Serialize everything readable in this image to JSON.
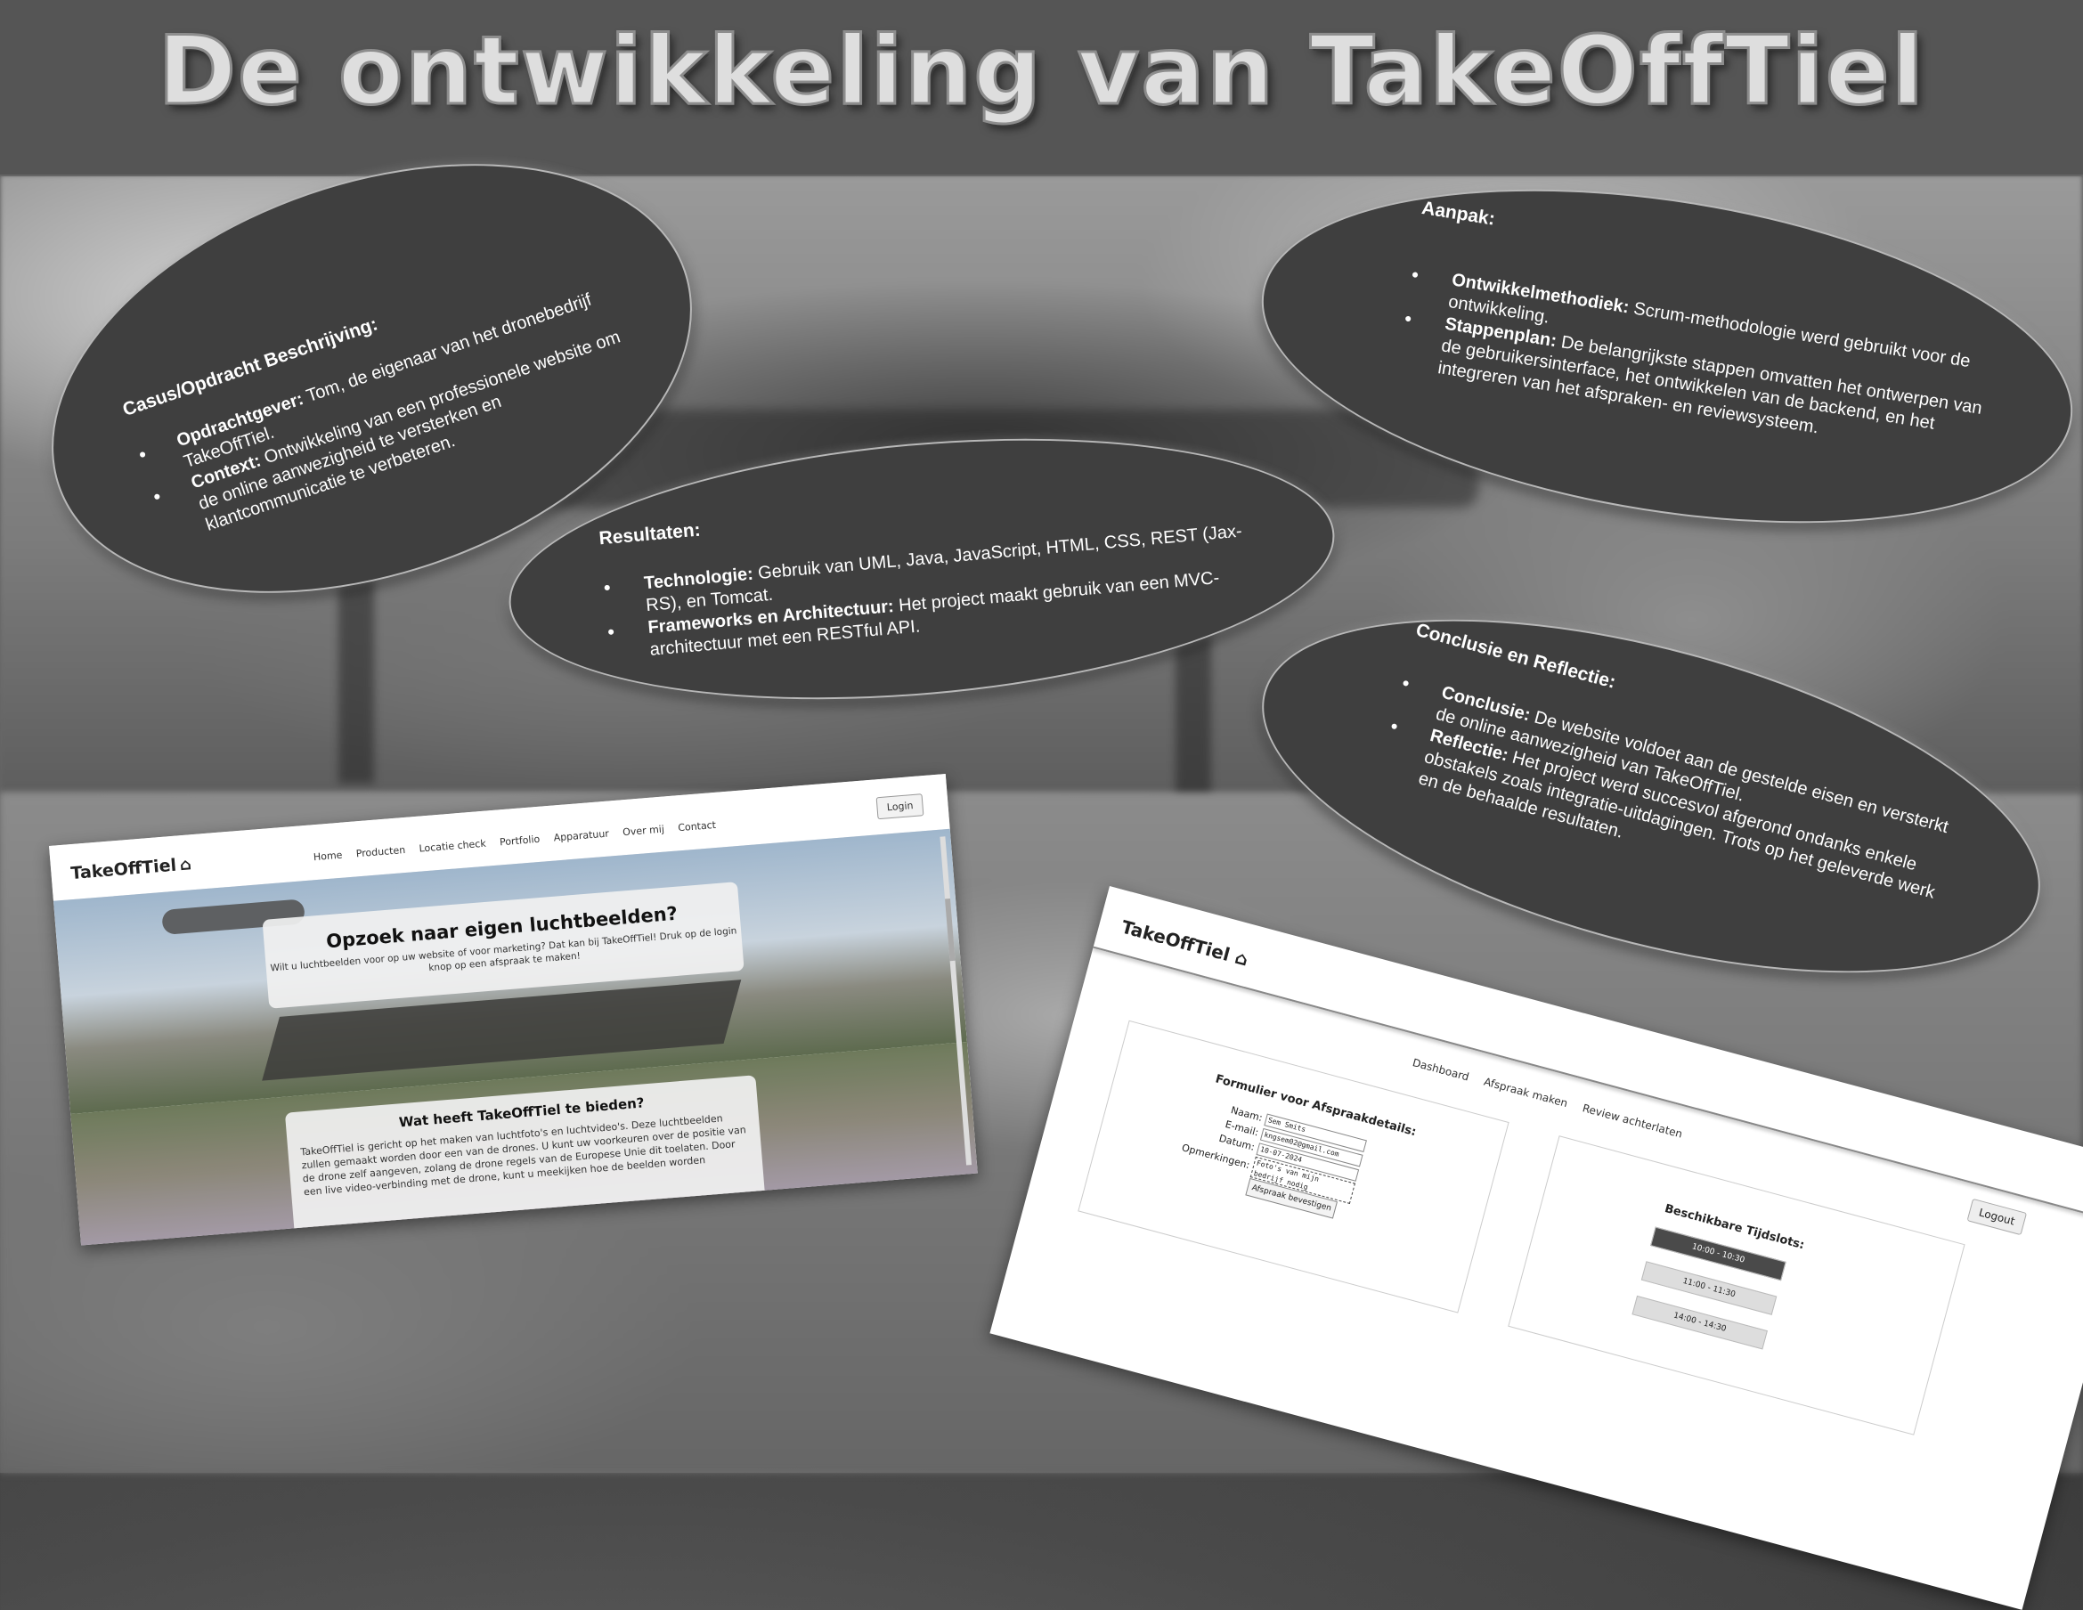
{
  "title": "De ontwikkeling van TakeOffTiel",
  "sections": {
    "casus": {
      "heading": "Casus/Opdracht Beschrijving:",
      "items": [
        {
          "label": "Opdrachtgever:",
          "text": " Tom, de eigenaar van het dronebedrijf TakeOffTiel."
        },
        {
          "label": "Context:",
          "text": " Ontwikkeling van een professionele website om de online aanwezigheid te versterken en klantcommunicatie te verbeteren."
        }
      ]
    },
    "resultaten": {
      "heading": "Resultaten:",
      "items": [
        {
          "label": "Technologie:",
          "text": " Gebruik van UML, Java, JavaScript, HTML, CSS, REST (Jax-RS), en Tomcat."
        },
        {
          "label": "Frameworks en Architectuur:",
          "text": " Het project maakt gebruik van een MVC-architectuur met een RESTful API."
        }
      ]
    },
    "aanpak": {
      "heading": "Aanpak:",
      "items": [
        {
          "label": "Ontwikkelmethodiek:",
          "text": " Scrum-methodologie werd gebruikt voor de ontwikkeling."
        },
        {
          "label": "Stappenplan:",
          "text": " De belangrijkste stappen omvatten het ontwerpen van de gebruikersinterface, het ontwikkelen van de backend, en het integreren van het afspraken- en reviewsysteem."
        }
      ]
    },
    "conclusie": {
      "heading": "Conclusie en Reflectie:",
      "items": [
        {
          "label": "Conclusie:",
          "text": " De website voldoet aan de gestelde eisen en versterkt de online aanwezigheid van TakeOffTiel."
        },
        {
          "label": "Reflectie:",
          "text": " Het project werd succesvol afgerond ondanks enkele obstakels zoals integratie-uitdagingen. Trots op het geleverde werk en de behaalde resultaten."
        }
      ]
    }
  },
  "homepage": {
    "logo": "TakeOffTiel",
    "nav": [
      "Home",
      "Producten",
      "Locatie check",
      "Portfolio",
      "Apparatuur",
      "Over mij",
      "Contact"
    ],
    "login": "Login",
    "hero_title": "Opzoek naar eigen luchtbeelden?",
    "hero_text": "Wilt u luchtbeelden voor op uw website of voor marketing? Dat kan bij TakeOffTiel! Druk op de login knop op een afspraak te maken!",
    "offer_title": "Wat heeft TakeOffTiel te bieden?",
    "offer_text": "TakeOffTiel is gericht op het maken van luchtfoto's en luchtvideo's. Deze luchtbeelden zullen gemaakt worden door een van de drones. U kunt uw voorkeuren over de positie van de drone zelf aangeven, zolang de drone regels van de Europese Unie dit toelaten. Door een live video-verbinding met de drone, kunt u meekijken hoe de beelden worden"
  },
  "dashboard": {
    "logo": "TakeOffTiel",
    "nav": [
      "Dashboard",
      "Afspraak maken",
      "Review achterlaten"
    ],
    "logout": "Logout",
    "form_title": "Formulier voor Afspraakdetails:",
    "form": {
      "name_label": "Naam:",
      "name_value": "Sem Smits",
      "email_label": "E-mail:",
      "email_value": "kngsem02@gmail.com",
      "date_label": "Datum:",
      "date_value": "10-07-2024",
      "remarks_label": "Opmerkingen:",
      "remarks_value": "Foto's van mijn bedrijf nodig",
      "submit": "Afspraak bevestigen"
    },
    "slots_title": "Beschikbare Tijdslots:",
    "slots": [
      "10:00 - 10:30",
      "11:00 - 11:30",
      "14:00 - 14:30"
    ]
  }
}
